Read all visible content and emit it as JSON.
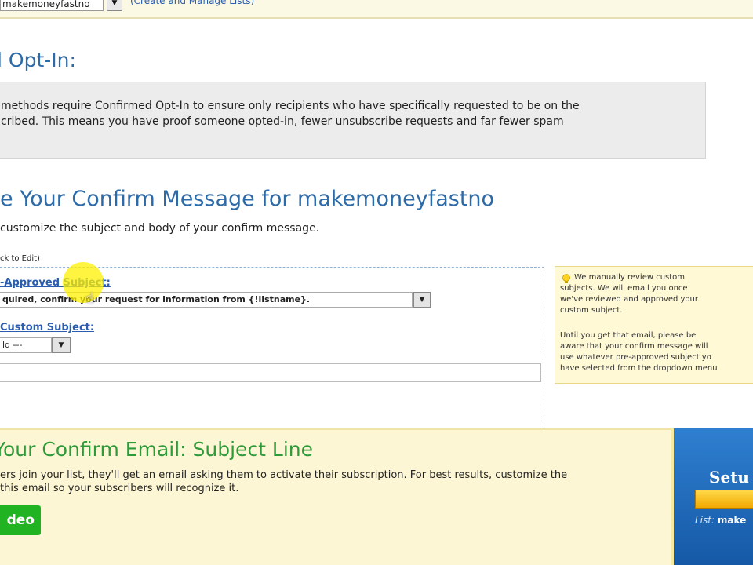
{
  "top_bar": {
    "list_select_value": "makemoneyfastno",
    "create_link": "(Create and Manage Lists)"
  },
  "optin": {
    "heading": "l Opt-In:",
    "info_lines": [
      "methods require Confirmed Opt-In to ensure only recipients who have specifically requested to be on the",
      "cribed. This means you have proof someone opted-in, fewer unsubscribe requests and far fewer spam"
    ]
  },
  "customize": {
    "heading": "e Your Confirm Message for makemoneyfastno",
    "description": "customize the subject and body of your confirm message.",
    "back_link": "ck to Edit)"
  },
  "editor": {
    "pre_approved_label": "-Approved Subject:",
    "pre_approved_value": "quired, confirm your request for information from {!listname}.",
    "custom_label": "Custom Subject:",
    "field_select_value": "ld ---",
    "custom_input_value": ""
  },
  "note": {
    "lines": [
      "We manually review custom",
      "subjects. We will email you once",
      "we've reviewed and approved your",
      "custom subject.",
      "",
      "Until you get that email, please be",
      "aware that your confirm message will",
      "use whatever pre-approved subject yo",
      "have selected from the dropdown menu"
    ]
  },
  "banner": {
    "title": "Your Confirm Email: Subject Line",
    "lines": [
      "ers join your list, they'll get an email asking them to activate their subscription. For best results, customize the",
      "this email so your subscribers will recognize it."
    ],
    "video_button": "deo"
  },
  "setup_panel": {
    "title": "Setu",
    "list_label": "List:",
    "list_value": "make"
  },
  "colors": {
    "heading_blue": "#2c6aa8",
    "banner_green": "#2f9a3a",
    "video_button_green": "#21b321",
    "note_background": "#fff9d6",
    "setup_blue": "#1559a6"
  },
  "icons": {
    "note": "lightbulb-icon",
    "dropdown": "chevron-down-icon",
    "cursor": "hand-cursor-icon"
  }
}
